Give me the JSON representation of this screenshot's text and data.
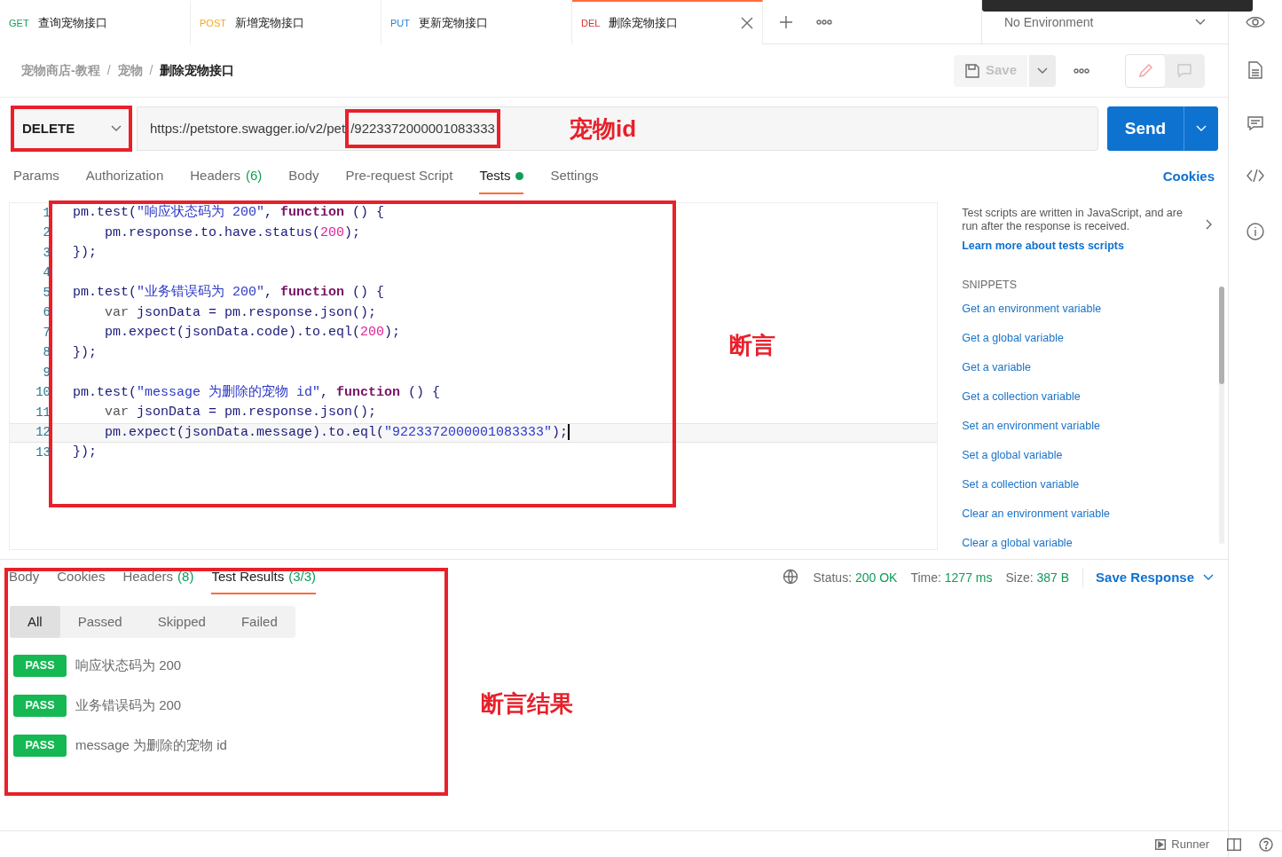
{
  "tabs": [
    {
      "method": "GET",
      "color": "#0f9d58",
      "title": "查询宠物接口",
      "selected": false
    },
    {
      "method": "POST",
      "color": "#f5a623",
      "title": "新增宠物接口",
      "selected": false
    },
    {
      "method": "PUT",
      "color": "#2a7fd4",
      "title": "更新宠物接口",
      "selected": false
    },
    {
      "method": "DEL",
      "color": "#d32f2f",
      "title": "删除宠物接口",
      "selected": true
    }
  ],
  "environment": "No Environment",
  "breadcrumb": [
    "宠物商店-教程",
    "宠物",
    "删除宠物接口"
  ],
  "breadcrumb_separators": [
    "/",
    "/"
  ],
  "view_toggle": [
    {
      "kind": "edit",
      "selected": true
    },
    {
      "kind": "comments",
      "selected": false
    }
  ],
  "save_button": {
    "label": "Save",
    "disabled": true
  },
  "request": {
    "method": "DELETE",
    "url_base": "https://petstore.swagger.io/v2/pet",
    "url_id": "/9223372000001083333",
    "send": "Send"
  },
  "request_tabs": [
    {
      "label": "Params",
      "selected": false
    },
    {
      "label": "Authorization",
      "selected": false
    },
    {
      "label": "Headers",
      "count": "(6)",
      "selected": false
    },
    {
      "label": "Body",
      "selected": false
    },
    {
      "label": "Pre-request Script",
      "selected": false
    },
    {
      "label": "Tests",
      "dot": true,
      "selected": true
    },
    {
      "label": "Settings",
      "selected": false
    }
  ],
  "cookies_link": "Cookies",
  "editor": {
    "lines": [
      {
        "number": "1",
        "current": false,
        "tokens": [
          {
            "kind": "plain",
            "text": "pm.test("
          },
          {
            "kind": "string",
            "text": "\"响应状态码为 200\""
          },
          {
            "kind": "plain",
            "text": ", "
          },
          {
            "kind": "keyword",
            "text": "function"
          },
          {
            "kind": "plain",
            "text": " () {"
          }
        ]
      },
      {
        "number": "2",
        "current": false,
        "tokens": [
          {
            "kind": "indent"
          },
          {
            "kind": "plain",
            "text": "pm.response.to.have.status("
          },
          {
            "kind": "number",
            "text": "200"
          },
          {
            "kind": "plain",
            "text": ");"
          }
        ]
      },
      {
        "number": "3",
        "current": false,
        "tokens": [
          {
            "kind": "plain",
            "text": "});"
          }
        ]
      },
      {
        "number": "4",
        "current": false
      },
      {
        "number": "5",
        "current": false,
        "tokens": [
          {
            "kind": "plain",
            "text": "pm.test("
          },
          {
            "kind": "string",
            "text": "\"业务错误码为 200\""
          },
          {
            "kind": "plain",
            "text": ", "
          },
          {
            "kind": "keyword",
            "text": "function"
          },
          {
            "kind": "plain",
            "text": " () {"
          }
        ]
      },
      {
        "number": "6",
        "current": false,
        "tokens": [
          {
            "kind": "indent"
          },
          {
            "kind": "var",
            "text": "var"
          },
          {
            "kind": "plain",
            "text": " jsonData = pm.response.json();"
          }
        ]
      },
      {
        "number": "7",
        "current": false,
        "tokens": [
          {
            "kind": "indent"
          },
          {
            "kind": "plain",
            "text": "pm.expect(jsonData.code).to.eql("
          },
          {
            "kind": "number",
            "text": "200"
          },
          {
            "kind": "plain",
            "text": ");"
          }
        ]
      },
      {
        "number": "8",
        "current": false,
        "tokens": [
          {
            "kind": "plain",
            "text": "});"
          }
        ]
      },
      {
        "number": "9",
        "current": false
      },
      {
        "number": "10",
        "current": false,
        "tokens": [
          {
            "kind": "plain",
            "text": "pm.test("
          },
          {
            "kind": "string",
            "text": "\"message 为删除的宠物 id\""
          },
          {
            "kind": "plain",
            "text": ", "
          },
          {
            "kind": "keyword",
            "text": "function"
          },
          {
            "kind": "plain",
            "text": " () {"
          }
        ]
      },
      {
        "number": "11",
        "current": false,
        "tokens": [
          {
            "kind": "indent"
          },
          {
            "kind": "var",
            "text": "var"
          },
          {
            "kind": "plain",
            "text": " jsonData = pm.response.json();"
          }
        ]
      },
      {
        "number": "12",
        "current": true,
        "tokens": [
          {
            "kind": "indent"
          },
          {
            "kind": "plain",
            "text": "pm.expect(jsonData.message).to.eql("
          },
          {
            "kind": "string",
            "text": "\"9223372000001083333\""
          },
          {
            "kind": "plain",
            "text": ");"
          }
        ]
      },
      {
        "number": "13",
        "current": false,
        "tokens": [
          {
            "kind": "plain",
            "text": "});"
          }
        ]
      }
    ]
  },
  "side_panel": {
    "description": "Test scripts are written in JavaScript, and are run after the response is received.",
    "link": "Learn more about tests scripts",
    "snippets_heading": "SNIPPETS",
    "snippets": [
      "Get an environment variable",
      "Get a global variable",
      "Get a variable",
      "Get a collection variable",
      "Set an environment variable",
      "Set a global variable",
      "Set a collection variable",
      "Clear an environment variable",
      "Clear a global variable"
    ]
  },
  "response_tabs": [
    {
      "label": "Body",
      "selected": false
    },
    {
      "label": "Cookies",
      "selected": false
    },
    {
      "label": "Headers",
      "count": "(8)",
      "selected": false
    },
    {
      "label": "Test Results",
      "count": "(3/3)",
      "selected": true
    }
  ],
  "response_meta": [
    {
      "label": "Status:",
      "value": "200 OK"
    },
    {
      "label": "Time:",
      "value": "1277 ms"
    },
    {
      "label": "Size:",
      "value": "387 B"
    }
  ],
  "save_response": "Save Response",
  "filters": [
    {
      "label": "All",
      "selected": true
    },
    {
      "label": "Passed",
      "selected": false
    },
    {
      "label": "Skipped",
      "selected": false
    },
    {
      "label": "Failed",
      "selected": false
    }
  ],
  "results": [
    {
      "status": "PASS",
      "name": "响应状态码为 200"
    },
    {
      "status": "PASS",
      "name": "业务错误码为 200"
    },
    {
      "status": "PASS",
      "name": "message 为删除的宠物 id"
    }
  ],
  "footer": {
    "runner": "Runner"
  },
  "annotations": [
    {
      "kind": "label",
      "text": "宠物id"
    },
    {
      "kind": "label",
      "text": "断言"
    },
    {
      "kind": "label",
      "text": "断言结果"
    }
  ]
}
